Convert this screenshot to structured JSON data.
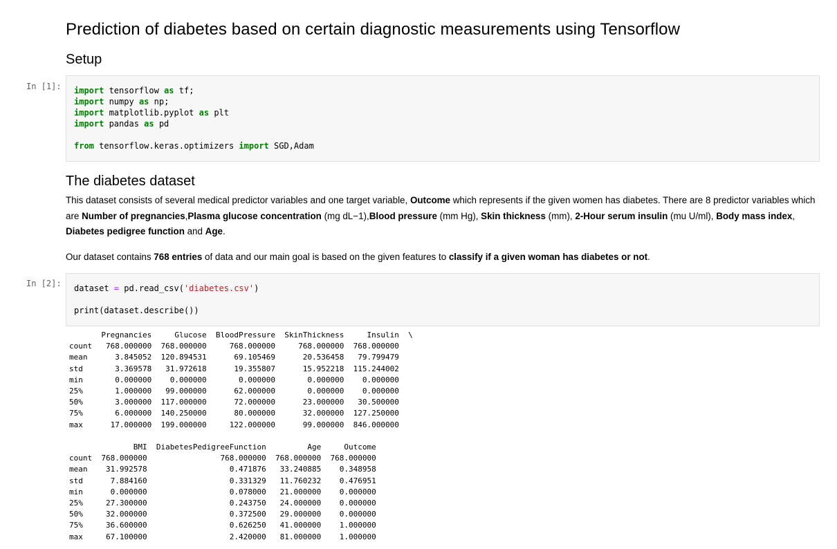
{
  "title": "Prediction of diabetes based on certain diagnostic measurements using Tensorflow",
  "sections": {
    "setup": "Setup",
    "dataset": "The diabetes dataset"
  },
  "cells": [
    {
      "prompt": "In [1]:",
      "lines": {
        "l1": {
          "kw1": "import",
          "rest": " tensorflow ",
          "kw2": "as",
          "tail": " tf;"
        },
        "l2": {
          "kw1": "import",
          "rest": " numpy ",
          "kw2": "as",
          "tail": " np;"
        },
        "l3": {
          "kw1": "import",
          "rest": " matplotlib.pyplot ",
          "kw2": "as",
          "tail": " plt"
        },
        "l4": {
          "kw1": "import",
          "rest": " pandas ",
          "kw2": "as",
          "tail": " pd"
        },
        "l5": {
          "kw1": "from",
          "rest": " tensorflow.keras.optimizers ",
          "kw2": "import",
          "tail": " SGD,Adam"
        }
      }
    },
    {
      "prompt": "In [2]:",
      "lines": {
        "l1": {
          "a": "dataset ",
          "op": "=",
          "b": " pd.read_csv(",
          "str": "'diabetes.csv'",
          "c": ")"
        },
        "l2": {
          "text": "print(dataset.describe())"
        }
      }
    }
  ],
  "markdown": {
    "p1": {
      "t1": "This dataset consists of several medical predictor variables and one target variable, ",
      "b1": "Outcome",
      "t2": " which represents if the given women has diabetes. There are 8 predictor variables which are ",
      "b2": "Number of pregnancies",
      "t3": ",",
      "b3": "Plasma glucose concentration",
      "t4": " (mg dL−1),",
      "b4": "Blood pressure",
      "t5": " (mm Hg), ",
      "b5": "Skin thickness",
      "t6": " (mm), ",
      "b6": "2-Hour serum insulin",
      "t7": " (mu U/ml), ",
      "b7": "Body mass index",
      "t8": ", ",
      "b8": "Diabetes pedigree function",
      "t9": " and ",
      "b9": "Age",
      "t10": "."
    },
    "p2": {
      "t1": "Our dataset contains ",
      "b1": "768 entries",
      "t2": " of data and our main goal is based on the given features to ",
      "b2": "classify if a given woman has diabetes or not",
      "t3": "."
    }
  },
  "output": {
    "table1": "       Pregnancies     Glucose  BloodPressure  SkinThickness     Insulin  \\\ncount   768.000000  768.000000     768.000000     768.000000  768.000000\nmean      3.845052  120.894531      69.105469      20.536458   79.799479\nstd       3.369578   31.972618      19.355807      15.952218  115.244002\nmin       0.000000    0.000000       0.000000       0.000000    0.000000\n25%       1.000000   99.000000      62.000000       0.000000    0.000000\n50%       3.000000  117.000000      72.000000      23.000000   30.500000\n75%       6.000000  140.250000      80.000000      32.000000  127.250000\nmax      17.000000  199.000000     122.000000      99.000000  846.000000",
    "table2": "              BMI  DiabetesPedigreeFunction         Age     Outcome\ncount  768.000000                768.000000  768.000000  768.000000\nmean    31.992578                  0.471876   33.240885    0.348958\nstd      7.884160                  0.331329   11.760232    0.476951\nmin      0.000000                  0.078000   21.000000    0.000000\n25%     27.300000                  0.243750   24.000000    0.000000\n50%     32.000000                  0.372500   29.000000    0.000000\n75%     36.600000                  0.626250   41.000000    1.000000\nmax     67.100000                  2.420000   81.000000    1.000000"
  }
}
